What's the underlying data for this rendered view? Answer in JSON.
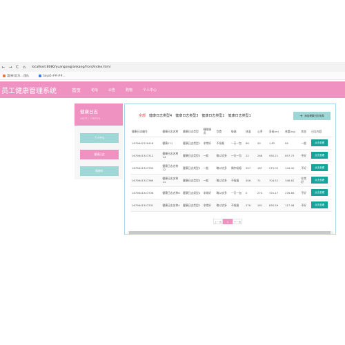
{
  "browser": {
    "nav_back": "←",
    "nav_forward": "→",
    "nav_reload": "C",
    "nav_home": "⌂",
    "url": "localhost:8080/yuangongjiankang/front/index.html"
  },
  "bookmarks": [
    {
      "label": "[超神]北京... 团队"
    },
    {
      "label": "Sayo5-##·##..."
    }
  ],
  "header": {
    "site_title": "员工健康管理系统",
    "menu": [
      "首页",
      "论坛",
      "公告",
      "购物",
      "个人中心"
    ]
  },
  "sidebar": {
    "title": "健康日志",
    "subtitle": "USER / CENTER",
    "buttons": [
      "个人中心",
      "健康日志",
      "购物车"
    ]
  },
  "filters": {
    "all": "全部",
    "types": [
      "健康日志类型4",
      "健康日志类型3",
      "健康日志类型2",
      "健康日志类型1"
    ]
  },
  "add_button": {
    "label": "添加健康日志信息"
  },
  "table": {
    "headers": [
      "健康日志编号",
      "健康日志名称",
      "健康日志类型",
      "睡眠情况",
      "饮食",
      "吸烟",
      "体温",
      "心率",
      "身高(m)",
      "体重(kg)",
      "状态",
      "日志内容"
    ],
    "rows": [
      [
        "1679642120416",
        "健康111",
        "健康日志类型1",
        "非常好",
        "不吸烟",
        "一天一包",
        "86",
        "59",
        "1.82",
        "65",
        "一般",
        "点击查看"
      ],
      [
        "1679641347312",
        "健康日志名称14",
        "健康日志类型3",
        "一般",
        "略以饮多",
        "一天一包",
        "22",
        "268",
        "930.21",
        "857.73",
        "不好",
        "点击查看"
      ],
      [
        "1679641347352",
        "健康日志名称12",
        "健康日志类型3",
        "一般",
        "略以饮多",
        "偶尔吸烟",
        "207",
        "187",
        "273.05",
        "144.40",
        "不好",
        "点击查看"
      ],
      [
        "1679641347369",
        "健康日志名称11",
        "健康日志类型3",
        "一般",
        "略以饮多",
        "不吸烟",
        "408",
        "71",
        "704.52",
        "348.62",
        "非常好",
        "点击查看"
      ],
      [
        "1679641347336",
        "健康日志名称6",
        "健康日志类型4",
        "非常好",
        "略以饮多",
        "一天一包",
        "0",
        "274",
        "725.17",
        "276.86",
        "不好",
        "点击查看"
      ],
      [
        "1679641347331",
        "健康日志名称4",
        "健康日志类型2",
        "非常好",
        "略以饮多",
        "不吸烟",
        "276",
        "161",
        "630.59",
        "117.48",
        "不好",
        "点击查看"
      ]
    ]
  },
  "pager": {
    "prev": "上一页",
    "current": "1",
    "next": "下一页"
  },
  "colors": {
    "brand_pink": "#ef92c1",
    "teal": "#9ed7d6",
    "view_button": "#15a39b"
  }
}
